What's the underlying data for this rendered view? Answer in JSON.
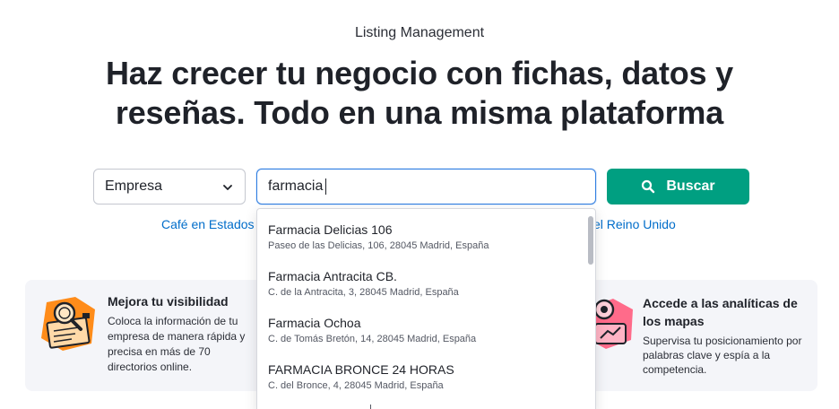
{
  "header": {
    "eyebrow": "Listing Management",
    "headline_line1": "Haz crecer tu negocio con fichas, datos y",
    "headline_line2": "reseñas. Todo en una misma plataforma"
  },
  "search": {
    "select_value": "Empresa",
    "input_value": "farmacia",
    "button_label": "Buscar"
  },
  "hints": {
    "left": "Café en Estados",
    "right": "el Reino Unido"
  },
  "dropdown": {
    "items": [
      {
        "name": "Farmacia Delicias 106",
        "address": "Paseo de las Delicias, 106, 28045 Madrid, España"
      },
      {
        "name": "Farmacia Antracita CB.",
        "address": "C. de la Antracita, 3, 28045 Madrid, España"
      },
      {
        "name": "Farmacia Ochoa",
        "address": "C. de Tomás Bretón, 14, 28045 Madrid, España"
      },
      {
        "name": "FARMACIA BRONCE 24 HORAS",
        "address": "C. del Bronce, 4, 28045 Madrid, España"
      }
    ]
  },
  "features": {
    "left": {
      "title": "Mejora tu visibilidad",
      "description": "Coloca la información de tu empresa de manera rápida y precisa en más de 70 directorios online.",
      "icon": "visibility-illustration-icon"
    },
    "right": {
      "title": "Accede a las analíticas de los mapas",
      "description": "Supervisa tu posicionamiento por palabras clave y espía a la competencia.",
      "icon": "map-analytics-illustration-icon"
    }
  },
  "colors": {
    "primary": "#009f81",
    "link": "#006dca",
    "focus": "#2f7de1",
    "panel": "#f4f5f9",
    "accent_orange": "#ff8c1a",
    "accent_pink": "#ff6b8a"
  }
}
